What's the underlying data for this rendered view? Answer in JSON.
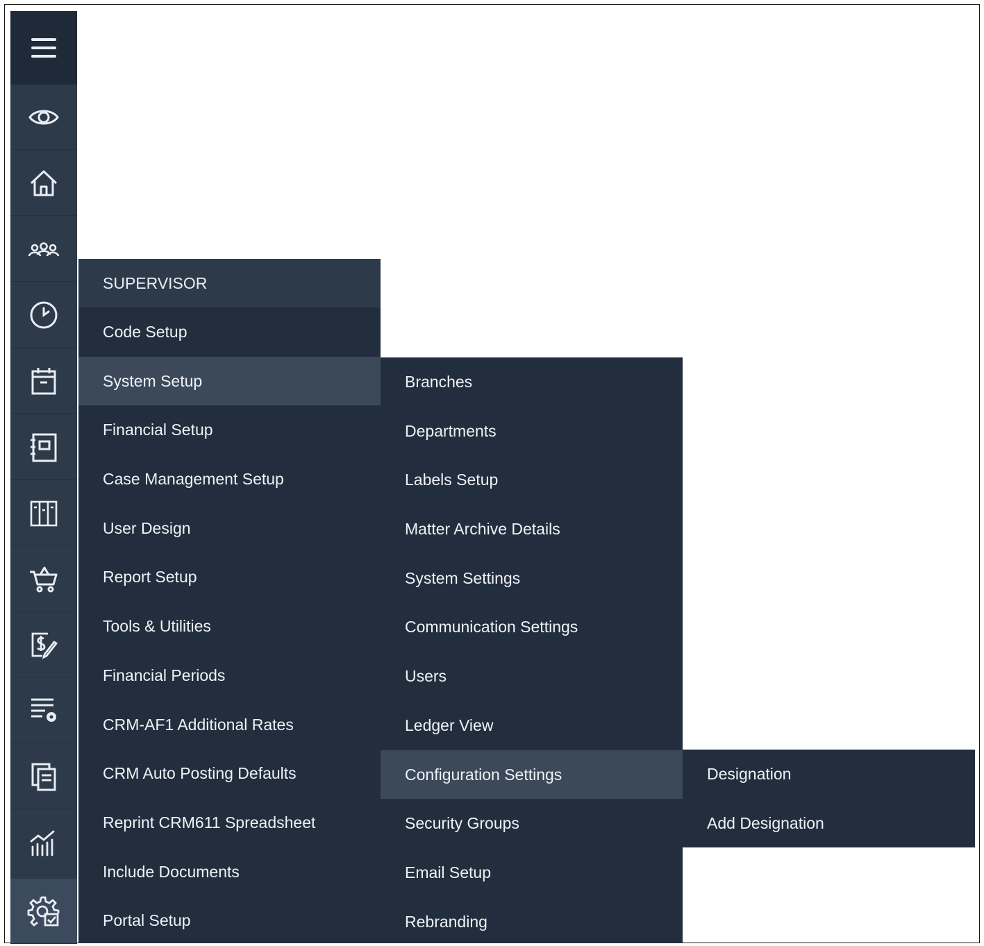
{
  "rail": {
    "items": [
      {
        "icon": "hamburger-menu-icon"
      },
      {
        "icon": "eye-icon"
      },
      {
        "icon": "home-icon"
      },
      {
        "icon": "users-icon"
      },
      {
        "icon": "clock-icon"
      },
      {
        "icon": "calendar-icon"
      },
      {
        "icon": "notebook-icon"
      },
      {
        "icon": "library-icon"
      },
      {
        "icon": "cart-icon"
      },
      {
        "icon": "billing-icon"
      },
      {
        "icon": "list-settings-icon"
      },
      {
        "icon": "documents-icon"
      },
      {
        "icon": "chart-icon"
      },
      {
        "icon": "supervisor-settings-icon",
        "active": true
      }
    ]
  },
  "menu1": {
    "header": "SUPERVISOR",
    "items": [
      "Code Setup",
      "System Setup",
      "Financial Setup",
      "Case Management Setup",
      "User Design",
      "Report Setup",
      "Tools & Utilities",
      "Financial Periods",
      "CRM-AF1 Additional Rates",
      "CRM Auto Posting Defaults",
      "Reprint CRM611 Spreadsheet",
      "Include Documents",
      "Portal Setup"
    ],
    "selected": "System Setup"
  },
  "menu2": {
    "items": [
      "Branches",
      "Departments",
      "Labels Setup",
      "Matter Archive Details",
      "System Settings",
      "Communication Settings",
      "Users",
      "Ledger View",
      "Configuration Settings",
      "Security Groups",
      "Email Setup",
      "Rebranding"
    ],
    "selected": "Configuration Settings"
  },
  "menu3": {
    "items": [
      "Designation",
      "Add Designation"
    ]
  },
  "colors": {
    "rail_bg": "#2d3a4a",
    "menu_bg": "#222e3d",
    "selected_bg": "#3b4959",
    "text": "#eef2f6"
  }
}
